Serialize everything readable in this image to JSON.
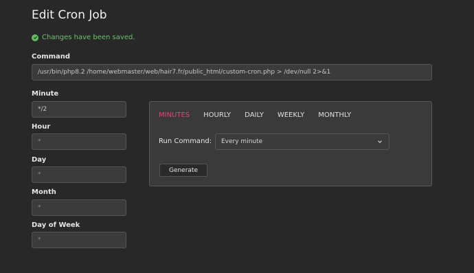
{
  "page": {
    "title": "Edit Cron Job"
  },
  "alert": {
    "text": "Changes have been saved."
  },
  "command": {
    "label": "Command",
    "value": "/usr/bin/php8.2 /home/webmaster/web/hair7.fr/public_html/custom-cron.php > /dev/null 2>&1"
  },
  "fields": {
    "minute": {
      "label": "Minute",
      "value": "*/2"
    },
    "hour": {
      "label": "Hour",
      "value": "*"
    },
    "day": {
      "label": "Day",
      "value": "*"
    },
    "month": {
      "label": "Month",
      "value": "*"
    },
    "day_of_week": {
      "label": "Day of Week",
      "value": "*"
    }
  },
  "generator": {
    "tabs": [
      {
        "label": "MINUTES",
        "active": true
      },
      {
        "label": "HOURLY",
        "active": false
      },
      {
        "label": "DAILY",
        "active": false
      },
      {
        "label": "WEEKLY",
        "active": false
      },
      {
        "label": "MONTHLY",
        "active": false
      }
    ],
    "run_command_label": "Run Command:",
    "run_command_value": "Every minute",
    "generate_label": "Generate"
  },
  "colors": {
    "accent": "#e0457b",
    "success": "#5fbf5f",
    "background": "#282828"
  },
  "icons": {
    "alert": "check-circle-icon",
    "select": "chevron-down-icon"
  }
}
